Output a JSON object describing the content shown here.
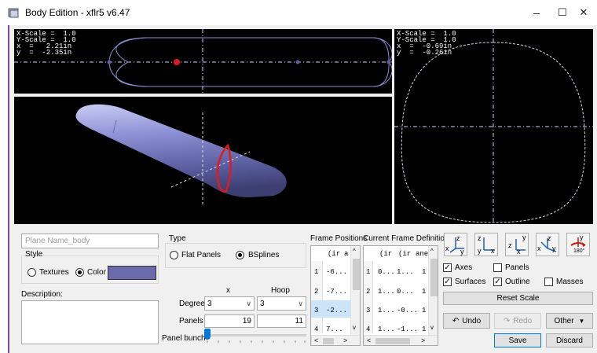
{
  "window": {
    "title": "Body Edition - xflr5 v6.47",
    "minimize": "–",
    "maximize": "☐",
    "close": "✕"
  },
  "views": {
    "top_left": {
      "xscale": "X-Scale =  1.0",
      "yscale": "Y-Scale =  1.0",
      "x": "x  =   2.21in",
      "y": "y  =  -2.35in"
    },
    "top_right": {
      "xscale": "X-Scale =  1.0",
      "yscale": "Y-Scale =  1.0",
      "x": "x  =  -0.69in",
      "y": "y  =  -0.26in"
    }
  },
  "body": {
    "plane_name_placeholder": "Plane Name_body",
    "style_title": "Style",
    "textures_label": "Textures",
    "color_label": "Color",
    "swatch_color": "#6b6aae",
    "description_label": "Description:",
    "description_value": ""
  },
  "type": {
    "title": "Type",
    "flat_panels": "Flat Panels",
    "bsplines": "BSplines"
  },
  "spline": {
    "col_x": "x",
    "col_hoop": "Hoop",
    "degree_label": "Degree",
    "degree_x": "3",
    "degree_hoop": "3",
    "panels_label": "Panels",
    "panels_x": "19",
    "panels_hoop": "11",
    "bunch_label": "Panel bunch",
    "bunch_level": 0
  },
  "frame_positions": {
    "title": "Frame Positions",
    "headers": [
      "(ir",
      "a"
    ],
    "rows": [
      {
        "n": "1",
        "v": "-6..."
      },
      {
        "n": "2",
        "v": "-7..."
      },
      {
        "n": "3",
        "v": "-2..."
      },
      {
        "n": "4",
        "v": "7..."
      }
    ]
  },
  "current_frame": {
    "title": "Current Frame Definition",
    "headers": [
      "(ir",
      "(ir",
      "ane"
    ],
    "rows": [
      {
        "n": "1",
        "a": "0...",
        "b": "1...",
        "c": "1"
      },
      {
        "n": "2",
        "a": "1...",
        "b": "0...",
        "c": "1"
      },
      {
        "n": "3",
        "a": "1...",
        "b": "-0...",
        "c": "1"
      },
      {
        "n": "4",
        "a": "1...",
        "b": "-1...",
        "c": "1"
      }
    ]
  },
  "view_buttons": {
    "iso": {
      "axis1": "z",
      "axis2": "x",
      "axis3": "y"
    },
    "front": {
      "axis1": "z",
      "axis2": "y",
      "axis3": "x"
    },
    "side": {
      "axis1": "y",
      "axis2": "z",
      "axis3": "x"
    },
    "top": {
      "axis1": "z",
      "axis2": "x",
      "axis3": "y"
    },
    "flip": {
      "axis1": "y",
      "label": "180°"
    }
  },
  "display": {
    "axes": "Axes",
    "panels": "Panels",
    "surfaces": "Surfaces",
    "outline": "Outline",
    "masses": "Masses",
    "reset_scale": "Reset Scale"
  },
  "actions": {
    "undo": "Undo",
    "redo": "Redo",
    "other": "Other",
    "save": "Save",
    "discard": "Discard"
  },
  "colors": {
    "body_fill": "#6f73b8",
    "frame_red": "#e01b1b",
    "outline_line": "#8c8fd6"
  }
}
